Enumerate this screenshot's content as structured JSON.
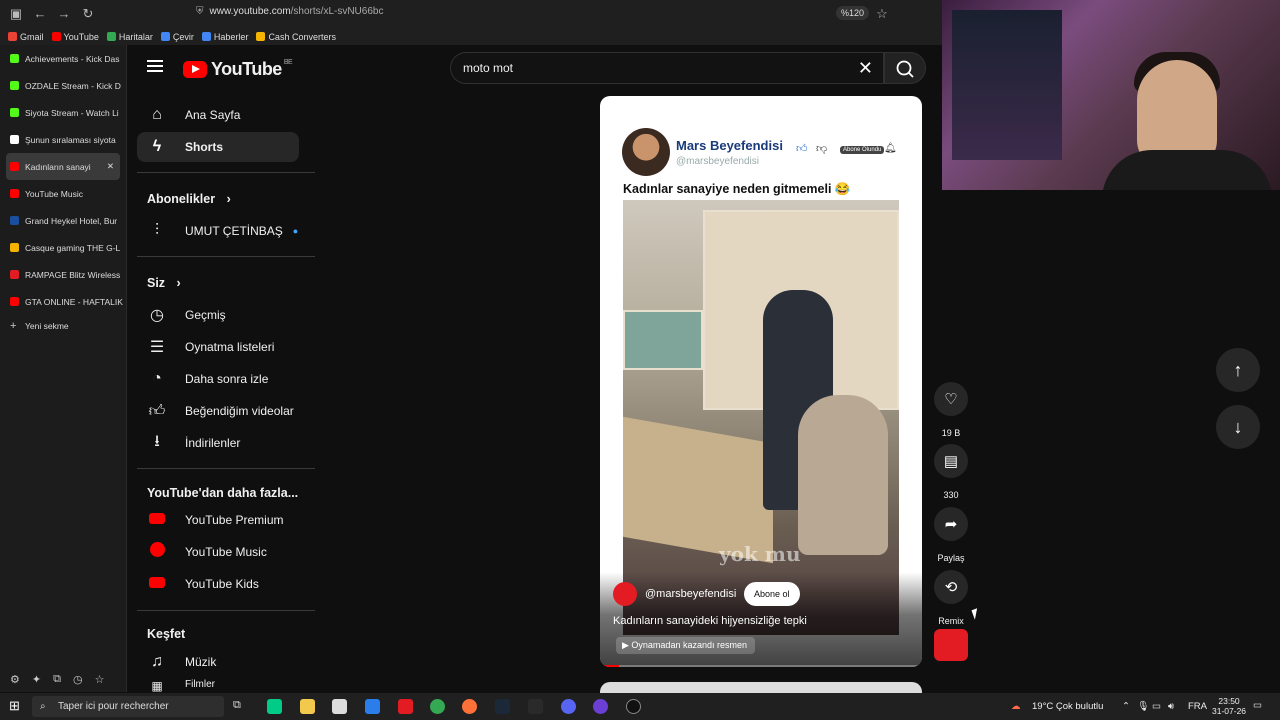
{
  "browser": {
    "url_domain": "www.youtube.com",
    "url_path": "/shorts/xL-svNU66bc",
    "zoom": "%120",
    "bookmarks": [
      "Gmail",
      "YouTube",
      "Haritalar",
      "Çevir",
      "Haberler",
      "Cash Converters"
    ],
    "bookmark_colors": [
      "#ea4335",
      "#ff0000",
      "#34a853",
      "#4285f4",
      "#4285f4",
      "#f4b400"
    ],
    "tabs": [
      {
        "label": "Achievements - Kick Das",
        "color": "#53fc18"
      },
      {
        "label": "OZDALE Stream - Kick D",
        "color": "#53fc18"
      },
      {
        "label": "Siyota Stream - Watch Li",
        "color": "#53fc18"
      },
      {
        "label": "Şunun sıralaması siyota",
        "color": "#ffffff"
      },
      {
        "label": "Kadınların sanayi",
        "color": "#ff0000",
        "active": true
      },
      {
        "label": "YouTube Music",
        "color": "#ff0000"
      },
      {
        "label": "Grand Heykel Hotel, Bur",
        "color": "#1a4fa0"
      },
      {
        "label": "Casque gaming THE G-L",
        "color": "#f4b400"
      },
      {
        "label": "RAMPAGE Blitz Wireless",
        "color": "#e31b23"
      },
      {
        "label": "GTA ONLINE - HAFTALIK",
        "color": "#ff0000"
      },
      {
        "label": "Yeni sekme",
        "color": "#888888"
      }
    ]
  },
  "youtube": {
    "logo_text": "YouTube",
    "region": "BE",
    "search_value": "moto mot",
    "sidebar": {
      "home": "Ana Sayfa",
      "shorts": "Shorts",
      "subs_heading": "Abonelikler",
      "subscription": "UMUT ÇETİNBAŞ",
      "you_heading": "Siz",
      "you_items": [
        "Geçmiş",
        "Oynatma listeleri",
        "Daha sonra izle",
        "Beğendiğim videolar",
        "İndirilenler"
      ],
      "more_heading": "YouTube'dan daha fazla...",
      "more_items": [
        "YouTube Premium",
        "YouTube Music",
        "YouTube Kids"
      ],
      "explore_heading": "Keşfet",
      "explore_items": [
        "Müzik",
        "Filmler"
      ]
    },
    "short": {
      "overlay_channel": "Mars Beyefendisi",
      "overlay_handle": "@marsbeyefendisi",
      "overlay_badge": "Abone Olundu",
      "overlay_title": "Kadınlar sanayiye neden gitmemeli 😂",
      "watermark": "yok mu",
      "channel": "@marsbeyefendisi",
      "subscribe": "Abone ol",
      "caption": "Kadınların sanayideki hijyensizliğe tepki",
      "chip": "Oynamadan kazandı resmen",
      "progress": 0.06
    },
    "actions": {
      "likes": "19 B",
      "comments": "330",
      "share": "Paylaş",
      "remix": "Remix"
    }
  },
  "taskbar": {
    "search_placeholder": "Taper ici pour rechercher",
    "weather": "19°C  Çok bulutlu",
    "language": "FRA",
    "time": "23:50",
    "date": "31-07-26"
  }
}
